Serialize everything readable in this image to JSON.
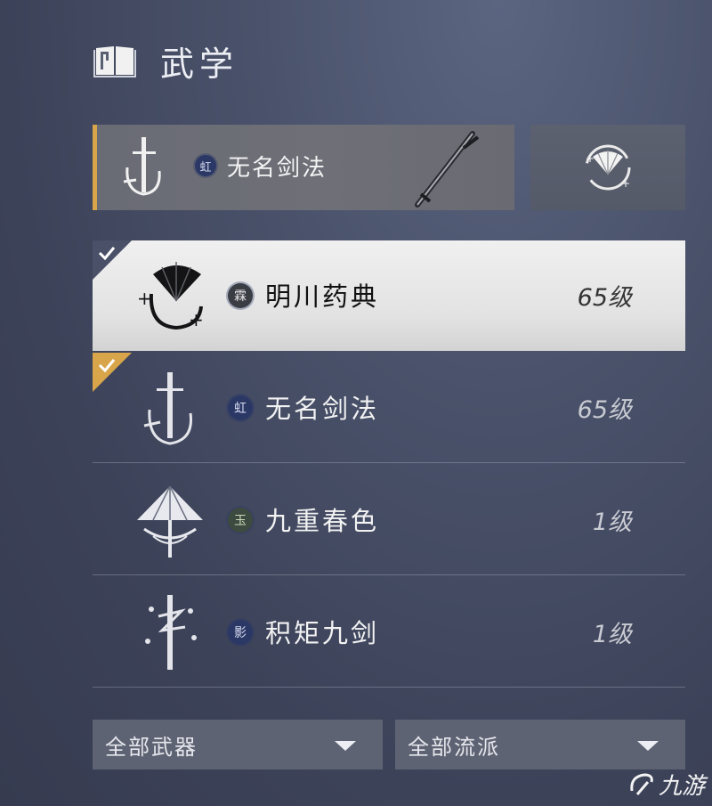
{
  "header": {
    "title": "武学"
  },
  "equipped": {
    "badge": "虹",
    "name": "无名剑法"
  },
  "skills": [
    {
      "badge": "霖",
      "name": "明川药典",
      "level": "65级",
      "selected": true
    },
    {
      "badge": "虹",
      "name": "无名剑法",
      "level": "65级"
    },
    {
      "badge": "玉",
      "name": "九重春色",
      "level": "1级"
    },
    {
      "badge": "影",
      "name": "积矩九剑",
      "level": "1级"
    }
  ],
  "filters": {
    "weapon": "全部武器",
    "school": "全部流派"
  },
  "watermark": {
    "text": "九游"
  },
  "colors": {
    "accent": "#d9a54a",
    "selected_row": "#e8e8e8",
    "panel": "#5e6374"
  }
}
